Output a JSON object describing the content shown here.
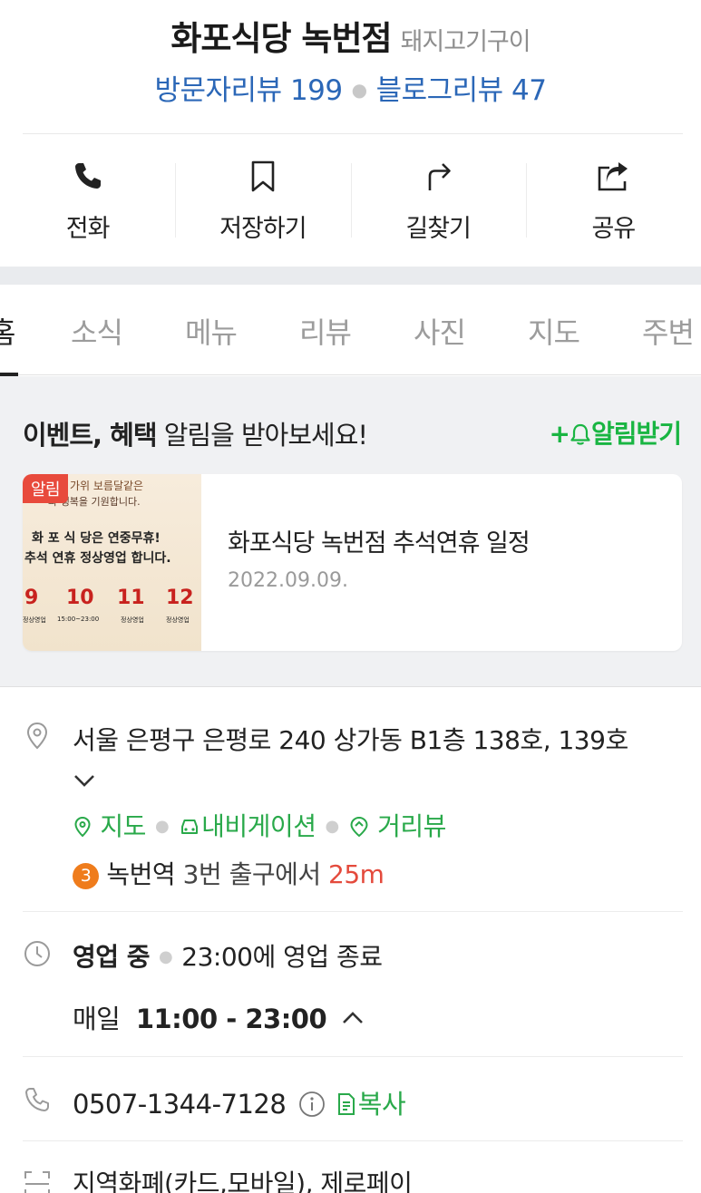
{
  "header": {
    "title": "화포식당 녹번점",
    "category": "돼지고기구이",
    "visitor_review": "방문자리뷰 199",
    "blog_review": "블로그리뷰 47"
  },
  "actions": [
    {
      "label": "전화",
      "icon": "phone-icon"
    },
    {
      "label": "저장하기",
      "icon": "bookmark-icon"
    },
    {
      "label": "길찾기",
      "icon": "directions-icon"
    },
    {
      "label": "공유",
      "icon": "share-icon"
    }
  ],
  "tabs": [
    "홈",
    "소식",
    "메뉴",
    "리뷰",
    "사진",
    "지도",
    "주변"
  ],
  "active_tab": "홈",
  "event": {
    "heading_bold": "이벤트, 혜택",
    "heading_rest": " 알림을 받아보세요!",
    "notify_label": "알림받기",
    "badge": "알림",
    "card_title": "화포식당 녹번점 추석연휴 일정",
    "card_date": "2022.09.09.",
    "thumb": {
      "line1": "가위 보름달같은",
      "line2": "과 행복을 기원합니다.",
      "line3": "화 포 식 당은 연중무휴!",
      "line4": "추석 연휴 정상영업 합니다.",
      "days": [
        "9",
        "10",
        "11",
        "12"
      ],
      "subs": [
        "정상영업",
        "15:00~23:00",
        "정상영업",
        "정상영업"
      ]
    }
  },
  "address": {
    "text": "서울 은평구 은평로 240 상가동 B1층 138호, 139호",
    "map_link": "지도",
    "nav_link": "내비게이션",
    "street_link": "거리뷰",
    "subway_line": "3",
    "station": "녹번역",
    "exit_text": " 3번 출구에서 ",
    "distance": "25m"
  },
  "hours": {
    "status": "영업 중",
    "closing": "23:00에 영업 종료",
    "day": "매일",
    "time": "11:00 - 23:00"
  },
  "phone": {
    "number": "0507-1344-7128",
    "copy_label": "복사"
  },
  "payment": {
    "text": "지역화폐(카드,모바일), 제로페이"
  },
  "colors": {
    "review_blue": "#2b67b7",
    "green": "#29a94a",
    "red": "#e44a3c",
    "subway_line3": "#ef7c1c"
  }
}
